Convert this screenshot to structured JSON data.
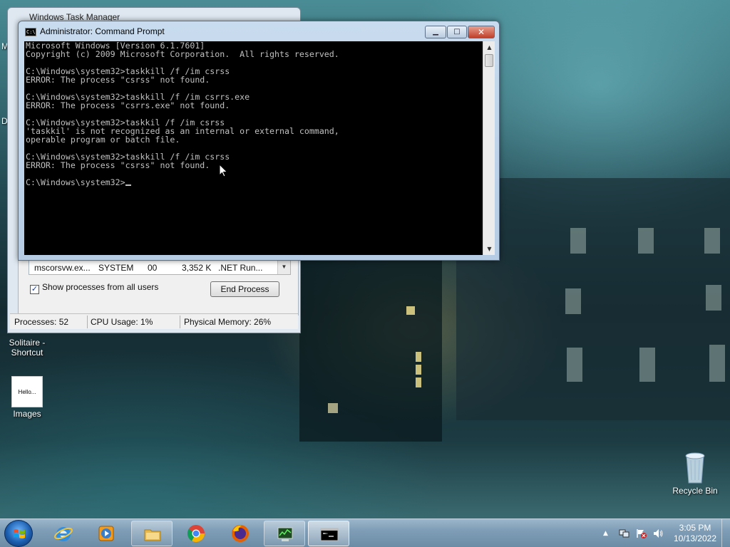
{
  "desktop": {
    "icons": [
      {
        "label_line1": "Solitaire -",
        "label_line2": "Shortcut"
      },
      {
        "thumb_text": "Hello...",
        "label": "Images"
      },
      {
        "label": "Recycle Bin"
      }
    ],
    "edge_letters": [
      "M",
      "D"
    ]
  },
  "task_manager": {
    "title": "Windows Task Manager",
    "process_row": {
      "name": "mscorsvw.ex...",
      "user": "SYSTEM",
      "cpu": "00",
      "memory": "3,352 K",
      "description": ".NET Run..."
    },
    "show_all_label": "Show processes from all users",
    "show_all_checked": true,
    "end_process_label": "End Process",
    "status": {
      "processes": "Processes: 52",
      "cpu": "CPU Usage: 1%",
      "memory": "Physical Memory: 26%"
    }
  },
  "cmd": {
    "title": "Administrator: Command Prompt",
    "icon_text": "C:\\",
    "lines": [
      "Microsoft Windows [Version 6.1.7601]",
      "Copyright (c) 2009 Microsoft Corporation.  All rights reserved.",
      "",
      "C:\\Windows\\system32>taskkill /f /im csrss",
      "ERROR: The process \"csrss\" not found.",
      "",
      "C:\\Windows\\system32>taskkill /f /im csrrs.exe",
      "ERROR: The process \"csrrs.exe\" not found.",
      "",
      "C:\\Windows\\system32>taskkil /f /im csrss",
      "'taskkil' is not recognized as an internal or external command,",
      "operable program or batch file.",
      "",
      "C:\\Windows\\system32>taskkill /f /im csrss",
      "ERROR: The process \"csrss\" not found.",
      "",
      "C:\\Windows\\system32>"
    ],
    "colors": {
      "background": "#000000",
      "text": "#c0c0c0"
    }
  },
  "taskbar": {
    "pinned": [
      "internet-explorer",
      "windows-media-player",
      "file-explorer",
      "chrome",
      "firefox",
      "task-manager",
      "command-prompt"
    ],
    "clock": {
      "time": "3:05 PM",
      "date": "10/13/2022"
    },
    "tray_arrow": "▲"
  }
}
